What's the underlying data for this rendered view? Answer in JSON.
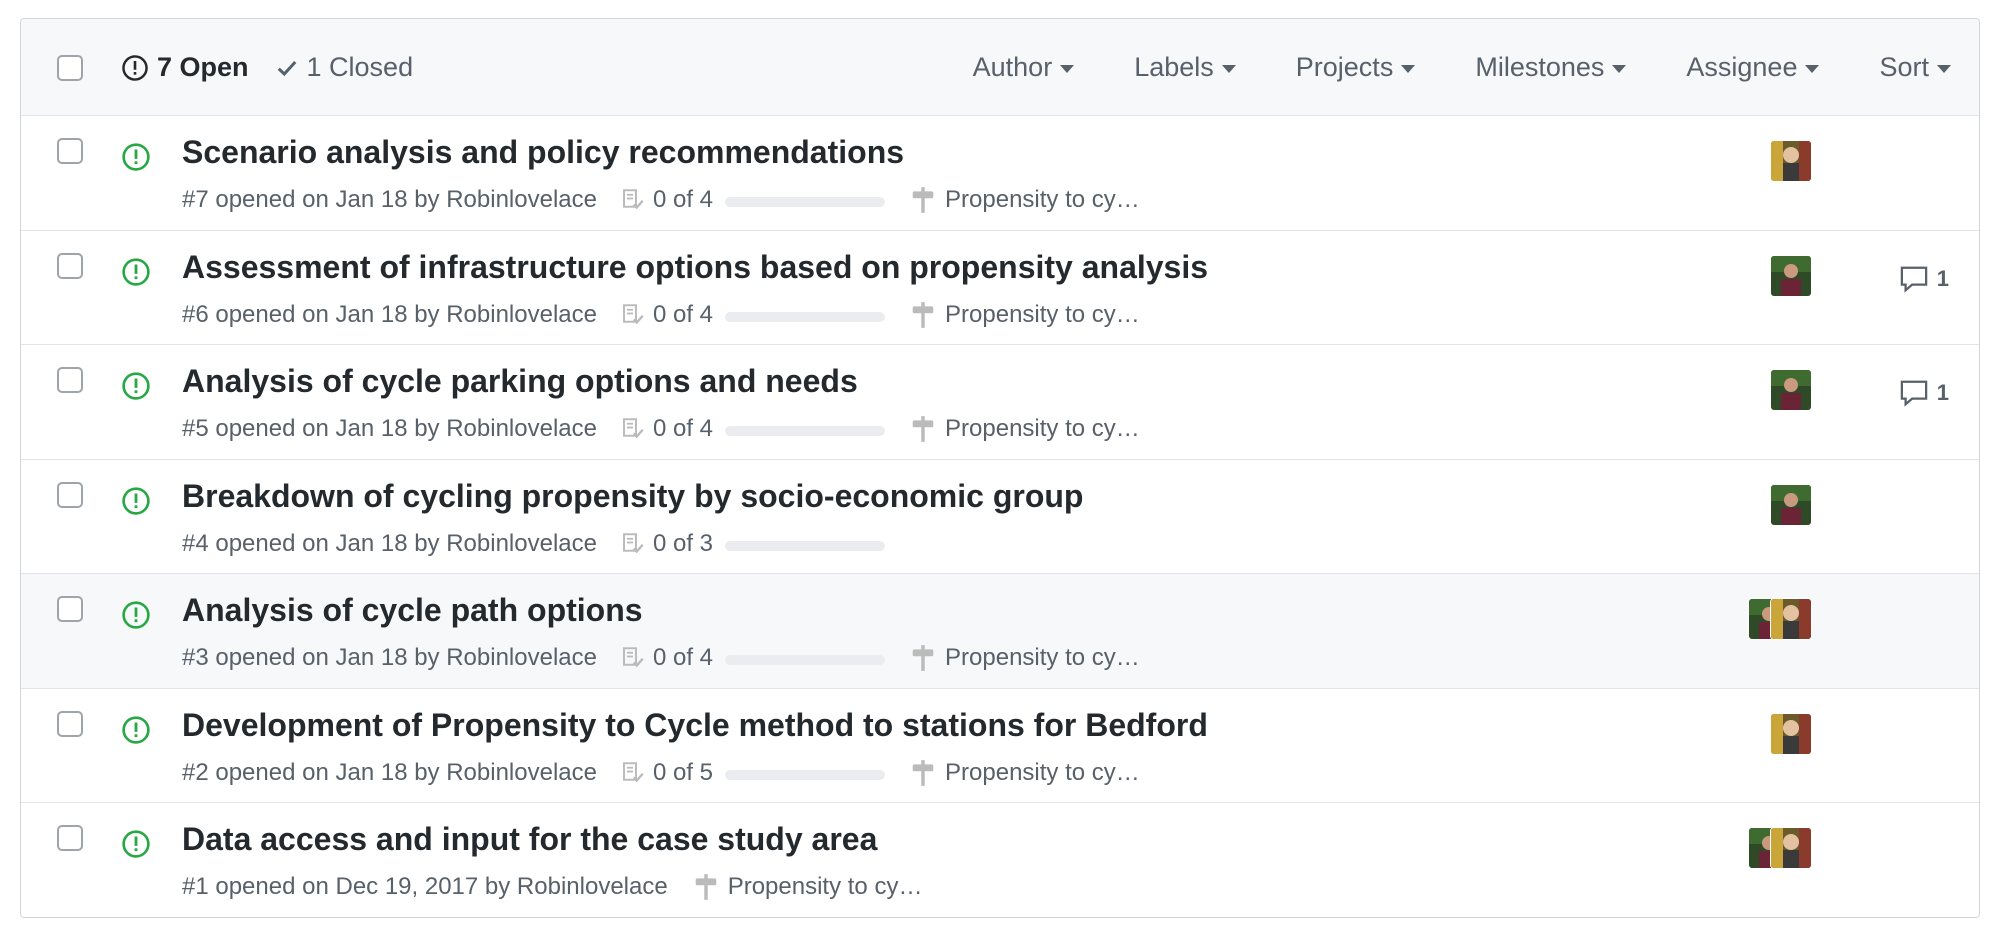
{
  "header": {
    "open_label": "7 Open",
    "closed_label": "1 Closed",
    "filters": [
      {
        "label": "Author"
      },
      {
        "label": "Labels"
      },
      {
        "label": "Projects"
      },
      {
        "label": "Milestones"
      },
      {
        "label": "Assignee"
      },
      {
        "label": "Sort"
      }
    ]
  },
  "colors": {
    "open_icon": "#28a745",
    "meta_text": "#586069",
    "progress_track": "#eaecef"
  },
  "issues": [
    {
      "title": "Scenario analysis and policy recommendations",
      "meta": "#7 opened on Jan 18 by Robinlovelace",
      "tasks": "0 of 4",
      "progress": 0,
      "milestone": "Propensity to cy…",
      "comments": "",
      "avatars": [
        "avatar-yellow"
      ]
    },
    {
      "title": "Assessment of infrastructure options based on propensity analysis",
      "meta": "#6 opened on Jan 18 by Robinlovelace",
      "tasks": "0 of 4",
      "progress": 0,
      "milestone": "Propensity to cy…",
      "comments": "1",
      "avatars": [
        "avatar-green"
      ]
    },
    {
      "title": "Analysis of cycle parking options and needs",
      "meta": "#5 opened on Jan 18 by Robinlovelace",
      "tasks": "0 of 4",
      "progress": 0,
      "milestone": "Propensity to cy…",
      "comments": "1",
      "avatars": [
        "avatar-green"
      ]
    },
    {
      "title": "Breakdown of cycling propensity by socio-economic group",
      "meta": "#4 opened on Jan 18 by Robinlovelace",
      "tasks": "0 of 3",
      "progress": 0,
      "milestone": "",
      "comments": "",
      "avatars": [
        "avatar-green"
      ]
    },
    {
      "title": "Analysis of cycle path options",
      "meta": "#3 opened on Jan 18 by Robinlovelace",
      "tasks": "0 of 4",
      "progress": 0,
      "milestone": "Propensity to cy…",
      "comments": "",
      "avatars": [
        "avatar-green",
        "avatar-yellow"
      ]
    },
    {
      "title": "Development of Propensity to Cycle method to stations for Bedford",
      "meta": "#2 opened on Jan 18 by Robinlovelace",
      "tasks": "0 of 5",
      "progress": 0,
      "milestone": "Propensity to cy…",
      "comments": "",
      "avatars": [
        "avatar-yellow"
      ]
    },
    {
      "title": "Data access and input for the case study area",
      "meta": "#1 opened on Dec 19, 2017 by Robinlovelace",
      "tasks": "",
      "progress": 0,
      "milestone": "Propensity to cy…",
      "comments": "",
      "avatars": [
        "avatar-green",
        "avatar-yellow"
      ]
    }
  ]
}
